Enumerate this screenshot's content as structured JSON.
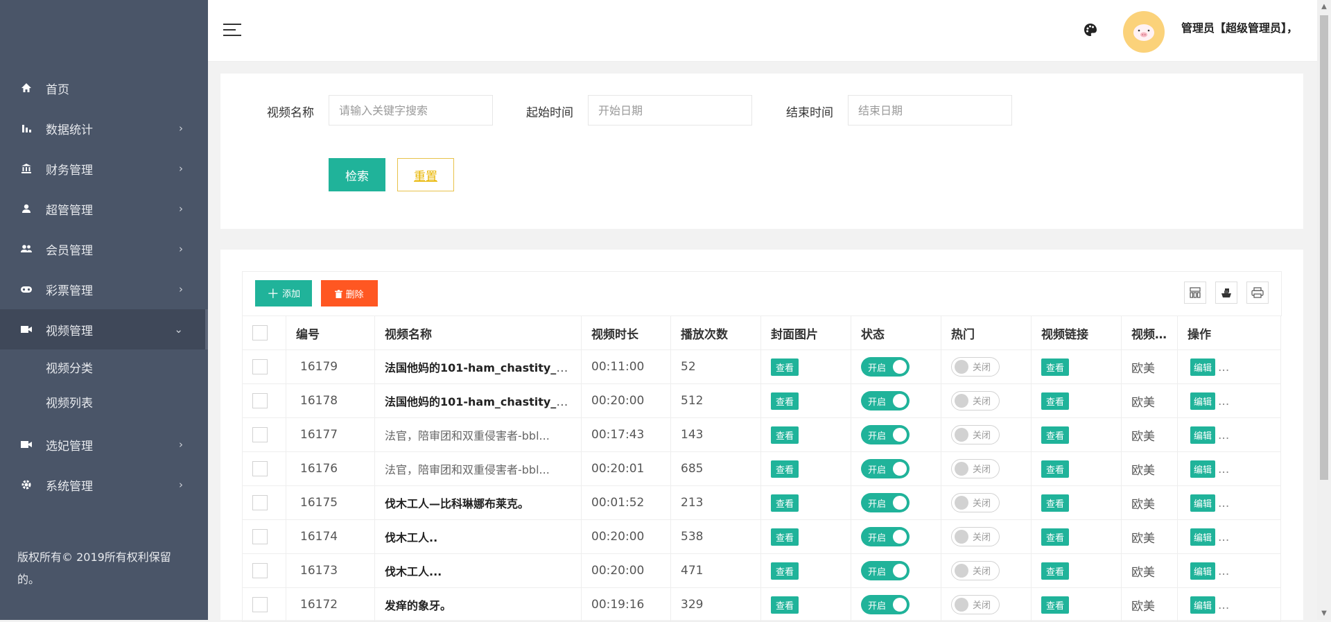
{
  "sidebar": {
    "items": [
      {
        "label": "首页",
        "icon": "home-icon",
        "arrow": ""
      },
      {
        "label": "数据统计",
        "icon": "bar-chart-icon",
        "arrow": "›"
      },
      {
        "label": "财务管理",
        "icon": "bank-icon",
        "arrow": "›"
      },
      {
        "label": "超管管理",
        "icon": "user-icon",
        "arrow": "›"
      },
      {
        "label": "会员管理",
        "icon": "users-icon",
        "arrow": "›"
      },
      {
        "label": "彩票管理",
        "icon": "gamepad-icon",
        "arrow": "›"
      },
      {
        "label": "视频管理",
        "icon": "video-icon",
        "arrow": "⌄"
      },
      {
        "label": "选妃管理",
        "icon": "video-icon",
        "arrow": "›"
      },
      {
        "label": "系统管理",
        "icon": "gear-icon",
        "arrow": "›"
      }
    ],
    "sub_items": [
      "视频分类",
      "视频列表"
    ],
    "copyright": "版权所有© 2019所有权利保留的。"
  },
  "header": {
    "user_name": "管理员【超级管理员】，"
  },
  "search": {
    "name_label": "视频名称",
    "name_placeholder": "请输入关键字搜索",
    "start_label": "起始时间",
    "start_placeholder": "开始日期",
    "end_label": "结束时间",
    "end_placeholder": "结束日期",
    "search_button": "检索",
    "reset_button": "重置"
  },
  "toolbar": {
    "add_label": "添加",
    "delete_label": "删除"
  },
  "table": {
    "headers": [
      "编号",
      "视频名称",
      "视频时长",
      "播放次数",
      "封面图片",
      "状态",
      "热门",
      "视频链接",
      "视频分类",
      "操作"
    ],
    "view_label": "查看",
    "on_label": "开启",
    "off_label": "关闭",
    "edit_label": "编辑",
    "more_label": "...",
    "rows": [
      {
        "id": "16179",
        "name": "法国他妈的101-ham_chastity_.....",
        "bold": true,
        "duration": "00:11:00",
        "plays": "52",
        "category": "欧美"
      },
      {
        "id": "16178",
        "name": "法国他妈的101-ham_chastity_.....",
        "bold": true,
        "duration": "00:20:00",
        "plays": "512",
        "category": "欧美"
      },
      {
        "id": "16177",
        "name": "法官，陪审团和双重侵害者-bbl...",
        "bold": false,
        "duration": "00:17:43",
        "plays": "143",
        "category": "欧美"
      },
      {
        "id": "16176",
        "name": "法官，陪审团和双重侵害者-bbl...",
        "bold": false,
        "duration": "00:20:01",
        "plays": "685",
        "category": "欧美"
      },
      {
        "id": "16175",
        "name": "伐木工人—比科琳娜布莱克。",
        "bold": true,
        "duration": "00:01:52",
        "plays": "213",
        "category": "欧美"
      },
      {
        "id": "16174",
        "name": "伐木工人..",
        "bold": true,
        "duration": "00:20:00",
        "plays": "538",
        "category": "欧美"
      },
      {
        "id": "16173",
        "name": "伐木工人...",
        "bold": true,
        "duration": "00:20:00",
        "plays": "471",
        "category": "欧美"
      },
      {
        "id": "16172",
        "name": "发痒的象牙。",
        "bold": true,
        "duration": "00:19:16",
        "plays": "329",
        "category": "欧美"
      }
    ]
  }
}
